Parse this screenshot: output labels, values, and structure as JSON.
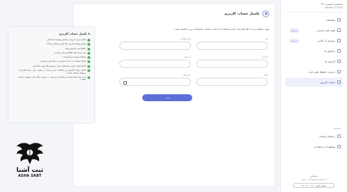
{
  "sidebar": {
    "date": "سه‌شنبه، ۷ بهمن ۱۴۰۲",
    "date_en": "2024 January 27",
    "items": [
      {
        "label": "پیشخوان",
        "icon": "home-icon",
        "badge": ""
      },
      {
        "label": "طرح های اینترنتی",
        "icon": "wifi-icon",
        "badge": "به زودی"
      },
      {
        "label": "سیستم آپ کامپ",
        "icon": "server-icon",
        "badge": "به زودی"
      },
      {
        "label": "تراکنش ها",
        "icon": "receipt-icon",
        "badge": ""
      },
      {
        "label": "گزارش ها",
        "icon": "chart-icon",
        "badge": ""
      },
      {
        "label": "مدیریت خطوط تلفن ثابت",
        "icon": "phone-icon",
        "badge": ""
      },
      {
        "label": "حساب کاربری",
        "icon": "user-icon",
        "badge": ""
      }
    ],
    "section_title": "پشتیبانی",
    "support_items": [
      {
        "label": "راهنمای سامانه",
        "icon": "help-icon"
      },
      {
        "label": "پیشنهادات و انتقادات",
        "icon": "chat-icon"
      }
    ],
    "support": {
      "title": "پشتیبانی",
      "subtitle": "از ساعت ۸ صبح الی ۱۰ شب",
      "phone": "شماره گیری ۲۰۲۰ ۹۱۰۰ ۰۲۱"
    }
  },
  "main": {
    "title": "تکمیل حساب کاربری",
    "description": "جهت مشاهده و ثبت خط های ثابت خود و استفاده از خدمات سامانه ، مشخصات زیر را تکمیل نمایید .",
    "fields": [
      {
        "label": "نام",
        "value": ""
      },
      {
        "label": "نام خانوادگی",
        "value": ""
      },
      {
        "label": "کدملی",
        "value": ""
      },
      {
        "label": "کد پستی",
        "value": ""
      },
      {
        "label": "ایمیل",
        "value": ""
      },
      {
        "label": "تاریخ تولد",
        "value": ""
      }
    ],
    "submit_label": "ثبت"
  },
  "info": {
    "title": "با تکمیل حساب کاربری",
    "items": [
      "امکان خرید مدیریت و نمایش وضعیت خط تلفن",
      "نمایش وضعیت قرض خط تلفن و امکان پرداخت",
      "ADSL ثبت نام طرح های",
      "خرید بسته های ADSL (زیبای پرداخت)",
      "مشاهده وضعیت و گزارشات",
      "امکان استفاده از خدمات اینترنتی به خط تلفن و اینترنت",
      "امکان فعال سازی و غیرفعال سازی سرویس های ویژه خط تلفن",
      "امکان دریافت گزارش ریز مکالمات (با رمز دوم - در صورت نیاز به بیان مکان یابی مربوطه مراجعه نمایید.)",
      "خرید بسته های اینترنت مرتبط (با رمز دوم - در صورت مکان یابی مربوطه مراجعه نمایید.)"
    ]
  },
  "logo": {
    "text_fa": "ثبت آشنا",
    "text_en": "ASHA SABT"
  },
  "colors": {
    "accent": "#5c6fd8",
    "check": "#4caf50"
  }
}
